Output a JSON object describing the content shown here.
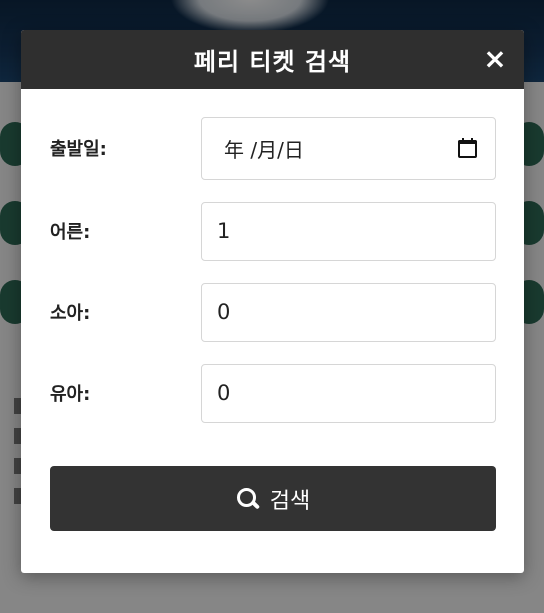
{
  "modal": {
    "title": "페리 티켓 검색",
    "close_label": "×"
  },
  "form": {
    "departure_label": "출발일:",
    "departure_value": "年 /月/日",
    "adult_label": "어른:",
    "adult_value": "1",
    "child_label": "소아:",
    "child_value": "0",
    "infant_label": "유아:",
    "infant_value": "0"
  },
  "search_button": {
    "label": "검색",
    "icon": "search-icon"
  },
  "colors": {
    "header_bg": "#2f2f2f",
    "button_bg": "#333333",
    "background_pill": "#2f6b57"
  }
}
